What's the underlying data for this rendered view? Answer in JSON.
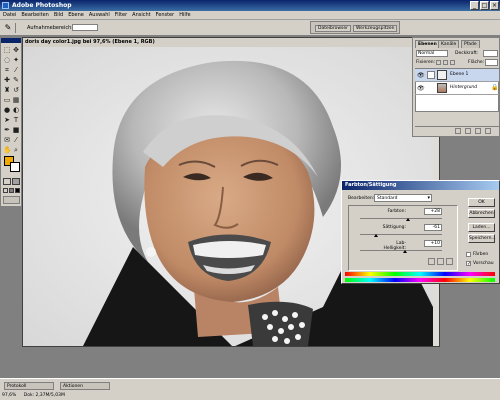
{
  "window": {
    "title": "Adobe Photoshop"
  },
  "menu": [
    "Datei",
    "Bearbeiten",
    "Bild",
    "Ebene",
    "Auswahl",
    "Filter",
    "Ansicht",
    "Fenster",
    "Hilfe"
  ],
  "options_bar": {
    "field_label": "Aufnahmebereich:",
    "tabs": [
      "Dateibrowser",
      "Werkzeugspitzen"
    ]
  },
  "document": {
    "title": "doris day color1.jpg bei 97,6% (Ebene 1, RGB)"
  },
  "layers_panel": {
    "tabs": [
      "Ebenen",
      "Kanäle",
      "Pfade"
    ],
    "mode": "Normal",
    "opacity_label": "Deckkraft:",
    "lock_label": "Fixieren:",
    "fill_label": "Fläche:",
    "layers": [
      {
        "name": "Ebene 1"
      },
      {
        "name": "Hintergrund"
      }
    ]
  },
  "dialog": {
    "title": "Farbton/Sättigung",
    "edit_label": "Bearbeiten:",
    "edit_value": "Standard",
    "sliders": [
      {
        "label": "Farbton:",
        "value": "+28",
        "pos": 0.58
      },
      {
        "label": "Sättigung:",
        "value": "-61",
        "pos": 0.2
      },
      {
        "label": "Lab-Helligkeit:",
        "value": "+10",
        "pos": 0.55
      }
    ],
    "buttons": [
      "OK",
      "Abbrechen",
      "Laden...",
      "Speichern..."
    ],
    "checkboxes": [
      {
        "label": "Färben",
        "checked": false
      },
      {
        "label": "Vorschau",
        "checked": true
      }
    ]
  },
  "status": {
    "zoom": "97,6%",
    "doc": "Dok: 2,37M/5,03M"
  },
  "minimized": [
    "Protokoll",
    "Aktionen"
  ]
}
